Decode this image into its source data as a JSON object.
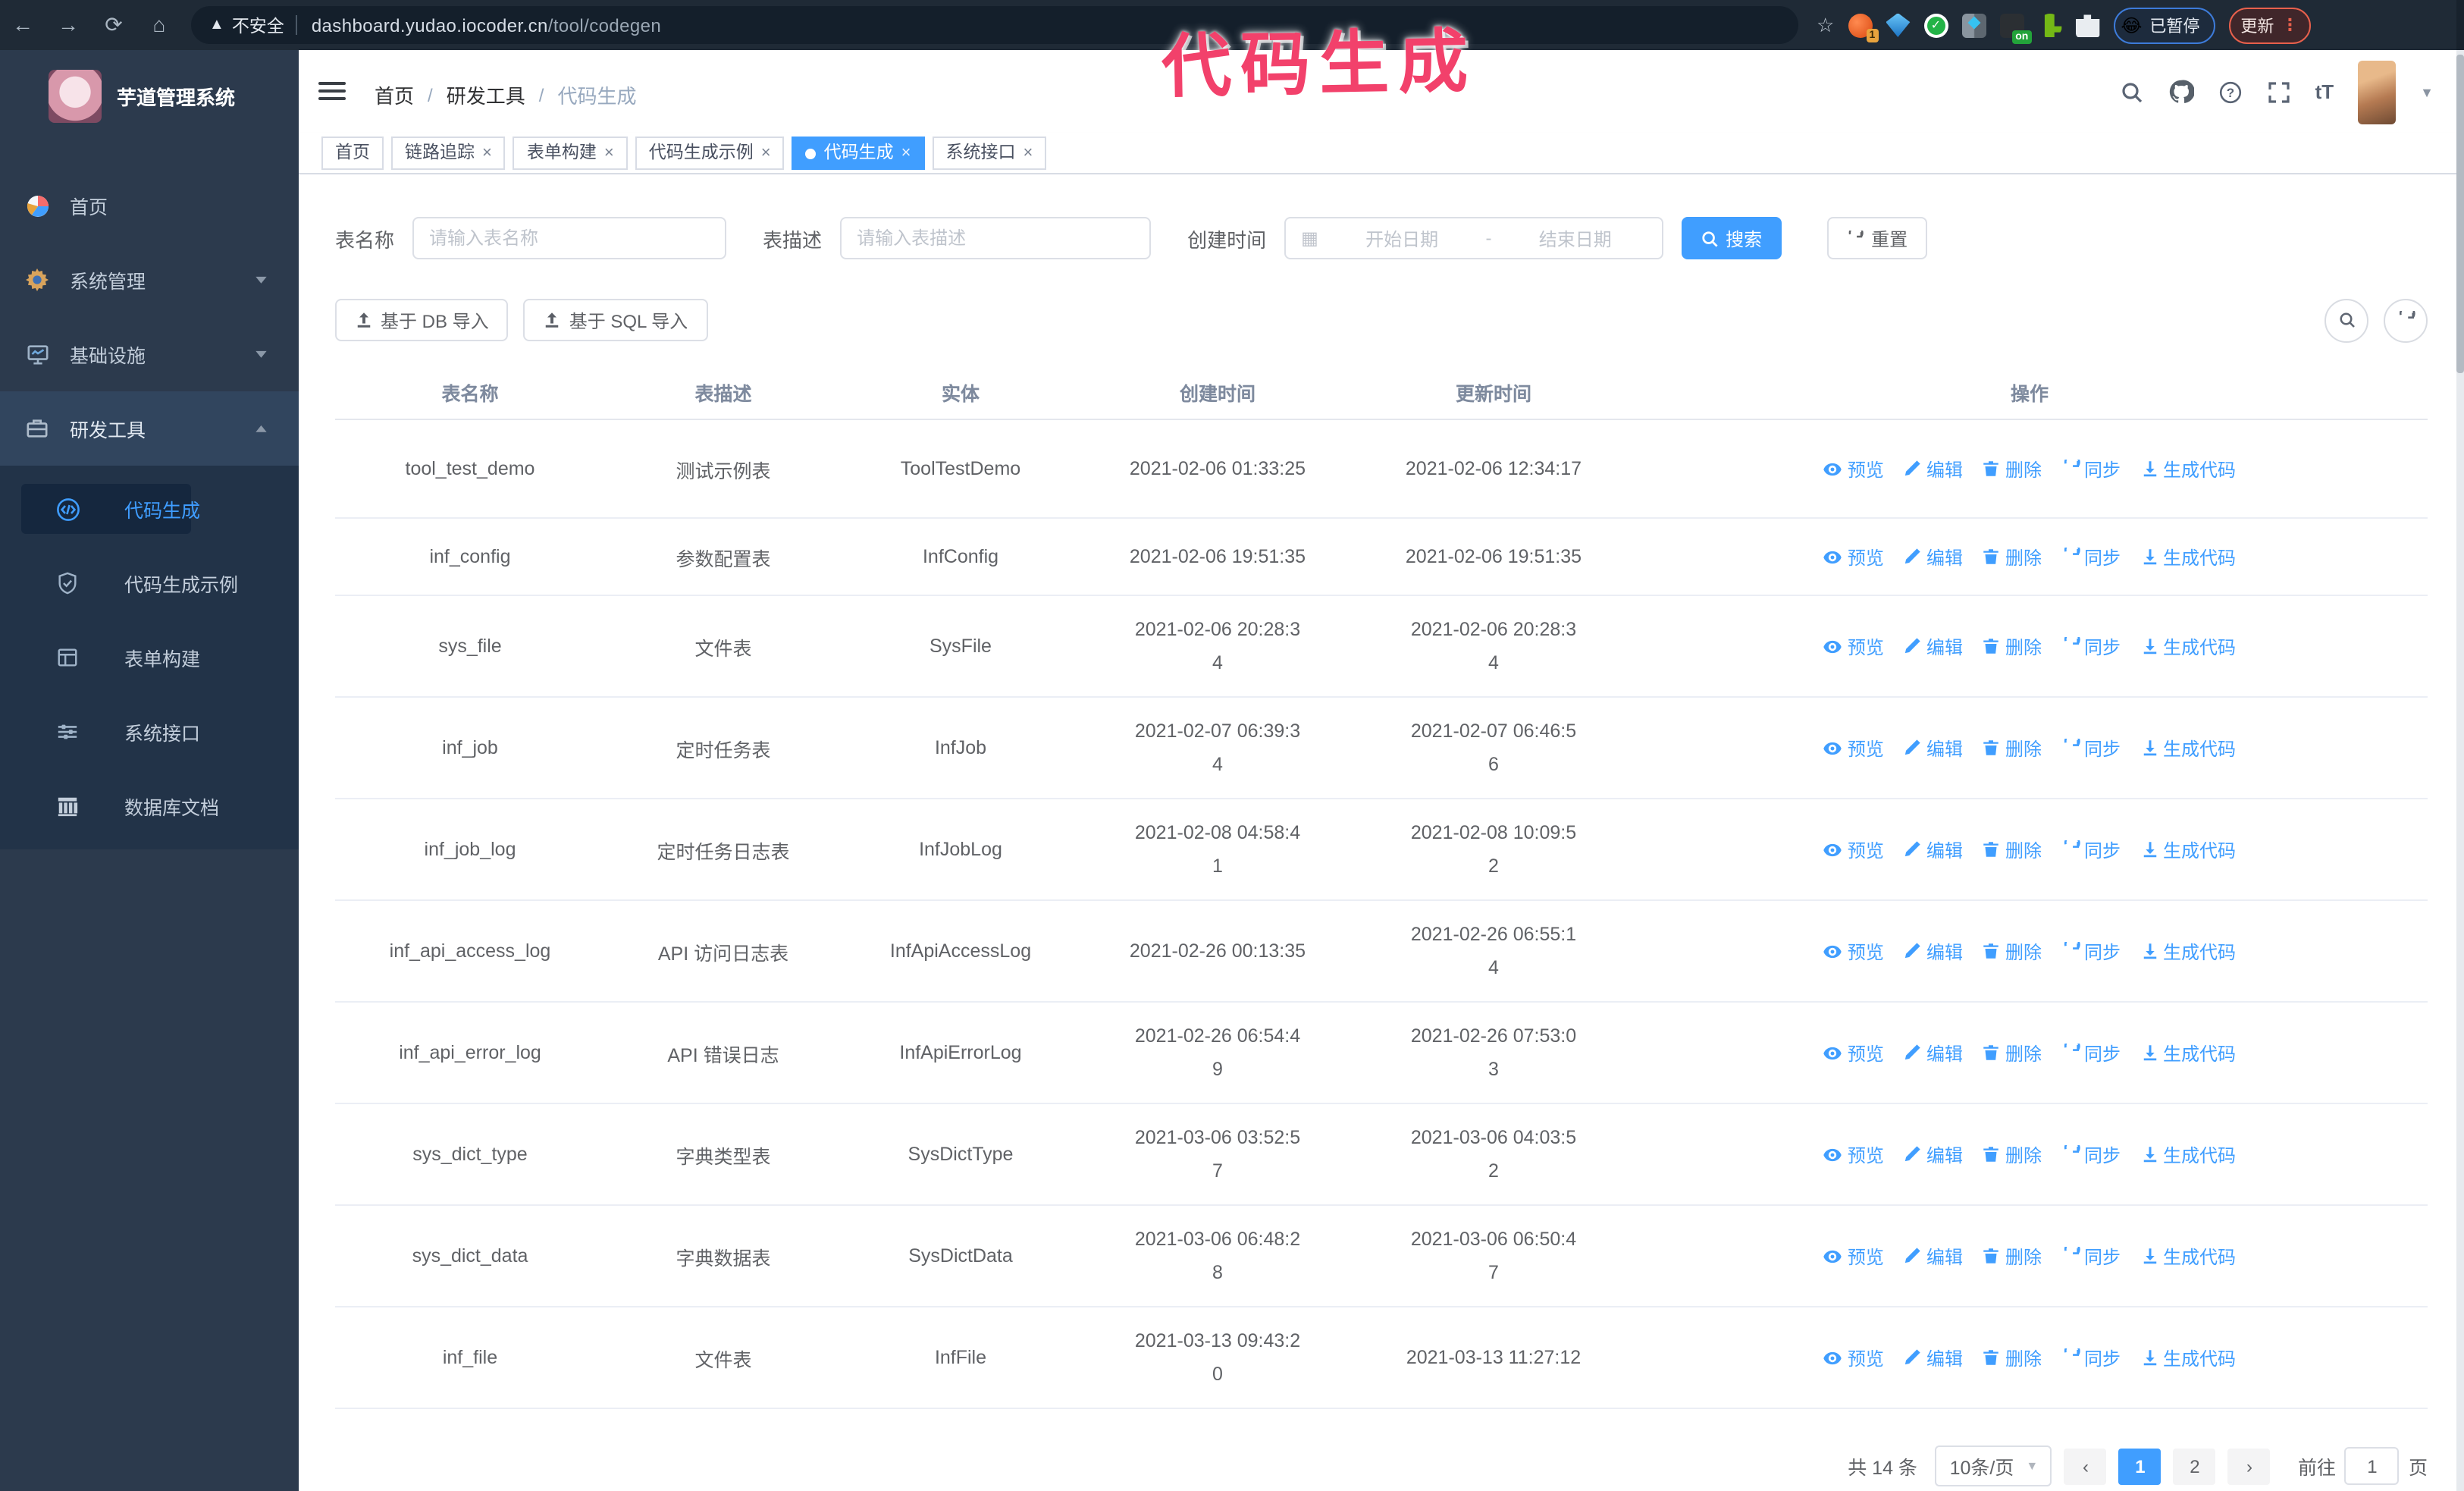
{
  "browser": {
    "security_label": "不安全",
    "url_host": "dashboard.yudao.iocoder.cn",
    "url_path": "/tool/codegen",
    "extension_badge_count": "1",
    "extension_on_badge": "on",
    "paused_badge": "已暂停",
    "update_button": "更新",
    "menu_dots": "⋮"
  },
  "watermark": "代码生成",
  "sidebar": {
    "title": "芋道管理系统",
    "items": [
      {
        "label": "首页",
        "icon": "dashboard-icon",
        "chevron": "",
        "key": "home"
      },
      {
        "label": "系统管理",
        "icon": "gear-icon",
        "chevron": "▾",
        "key": "system"
      },
      {
        "label": "基础设施",
        "icon": "monitor-icon",
        "chevron": "▾",
        "key": "infra"
      },
      {
        "label": "研发工具",
        "icon": "briefcase-icon",
        "chevron": "▴",
        "key": "devtools",
        "open": true
      }
    ],
    "submenu": [
      {
        "label": "代码生成",
        "icon": "code-icon",
        "active": true
      },
      {
        "label": "代码生成示例",
        "icon": "badge-check-icon",
        "active": false
      },
      {
        "label": "表单构建",
        "icon": "form-icon",
        "active": false
      },
      {
        "label": "系统接口",
        "icon": "sliders-icon",
        "active": false
      },
      {
        "label": "数据库文档",
        "icon": "table-grid-icon",
        "active": false
      }
    ]
  },
  "header": {
    "breadcrumb": [
      "首页",
      "研发工具",
      "代码生成"
    ]
  },
  "tabs": [
    {
      "label": "首页",
      "closable": false,
      "active": false
    },
    {
      "label": "链路追踪",
      "closable": true,
      "active": false
    },
    {
      "label": "表单构建",
      "closable": true,
      "active": false
    },
    {
      "label": "代码生成示例",
      "closable": true,
      "active": false
    },
    {
      "label": "代码生成",
      "closable": true,
      "active": true
    },
    {
      "label": "系统接口",
      "closable": true,
      "active": false
    }
  ],
  "filters": {
    "table_name_label": "表名称",
    "table_name_placeholder": "请输入表名称",
    "table_desc_label": "表描述",
    "table_desc_placeholder": "请输入表描述",
    "create_time_label": "创建时间",
    "start_placeholder": "开始日期",
    "range_separator": "-",
    "end_placeholder": "结束日期",
    "search_button": "搜索",
    "reset_button": "重置"
  },
  "toolbar": {
    "import_db_button": "基于 DB 导入",
    "import_sql_button": "基于 SQL 导入"
  },
  "table": {
    "columns": [
      "表名称",
      "表描述",
      "实体",
      "创建时间",
      "更新时间",
      "操作"
    ],
    "actions": [
      {
        "label": "预览",
        "icon": "eye-icon"
      },
      {
        "label": "编辑",
        "icon": "edit-icon"
      },
      {
        "label": "删除",
        "icon": "trash-icon"
      },
      {
        "label": "同步",
        "icon": "sync-icon"
      },
      {
        "label": "生成代码",
        "icon": "download-icon"
      }
    ],
    "rows": [
      {
        "name": "tool_test_demo",
        "description": "测试示例表",
        "entity": "ToolTestDemo",
        "created_at": "2021-02-06 01:33:25",
        "updated_at": "2021-02-06 12:34:17",
        "h": "h64"
      },
      {
        "name": "inf_config",
        "description": "参数配置表",
        "entity": "InfConfig",
        "created_at": "2021-02-06 19:51:35",
        "updated_at": "2021-02-06 19:51:35",
        "h": "h50"
      },
      {
        "name": "sys_file",
        "description": "文件表",
        "entity": "SysFile",
        "created_at": "2021-02-06 20:28:3\n4",
        "updated_at": "2021-02-06 20:28:3\n4",
        "h": "h67"
      },
      {
        "name": "inf_job",
        "description": "定时任务表",
        "entity": "InfJob",
        "created_at": "2021-02-07 06:39:3\n4",
        "updated_at": "2021-02-07 06:46:5\n6",
        "h": "h67"
      },
      {
        "name": "inf_job_log",
        "description": "定时任务日志表",
        "entity": "InfJobLog",
        "created_at": "2021-02-08 04:58:4\n1",
        "updated_at": "2021-02-08 10:09:5\n2",
        "h": "h67"
      },
      {
        "name": "inf_api_access_log",
        "description": "API 访问日志表",
        "entity": "InfApiAccessLog",
        "created_at": "2021-02-26 00:13:35",
        "updated_at": "2021-02-26 06:55:1\n4",
        "h": "h67"
      },
      {
        "name": "inf_api_error_log",
        "description": "API 错误日志",
        "entity": "InfApiErrorLog",
        "created_at": "2021-02-26 06:54:4\n9",
        "updated_at": "2021-02-26 07:53:0\n3",
        "h": "h67"
      },
      {
        "name": "sys_dict_type",
        "description": "字典类型表",
        "entity": "SysDictType",
        "created_at": "2021-03-06 03:52:5\n7",
        "updated_at": "2021-03-06 04:03:5\n2",
        "h": "h67"
      },
      {
        "name": "sys_dict_data",
        "description": "字典数据表",
        "entity": "SysDictData",
        "created_at": "2021-03-06 06:48:2\n8",
        "updated_at": "2021-03-06 06:50:4\n7",
        "h": "h67"
      },
      {
        "name": "inf_file",
        "description": "文件表",
        "entity": "InfFile",
        "created_at": "2021-03-13 09:43:2\n0",
        "updated_at": "2021-03-13 11:27:12",
        "h": "h67"
      }
    ]
  },
  "pagination": {
    "total_label": "共 14 条",
    "page_size_label": "10条/页",
    "prev_label": "‹",
    "next_label": "›",
    "pages": [
      "1",
      "2"
    ],
    "active_page": "1",
    "goto_label": "前往",
    "goto_value": "1",
    "unit_label": "页"
  },
  "colors": {
    "primary": "#409eff",
    "watermark_pink": "#f2416b",
    "browser_bar": "#1f2a36",
    "sidebar_bg": "#2c3a4d",
    "submenu_bg": "#223348",
    "update_accent": "#e8604c",
    "paused_accent": "#3d7bd9"
  }
}
